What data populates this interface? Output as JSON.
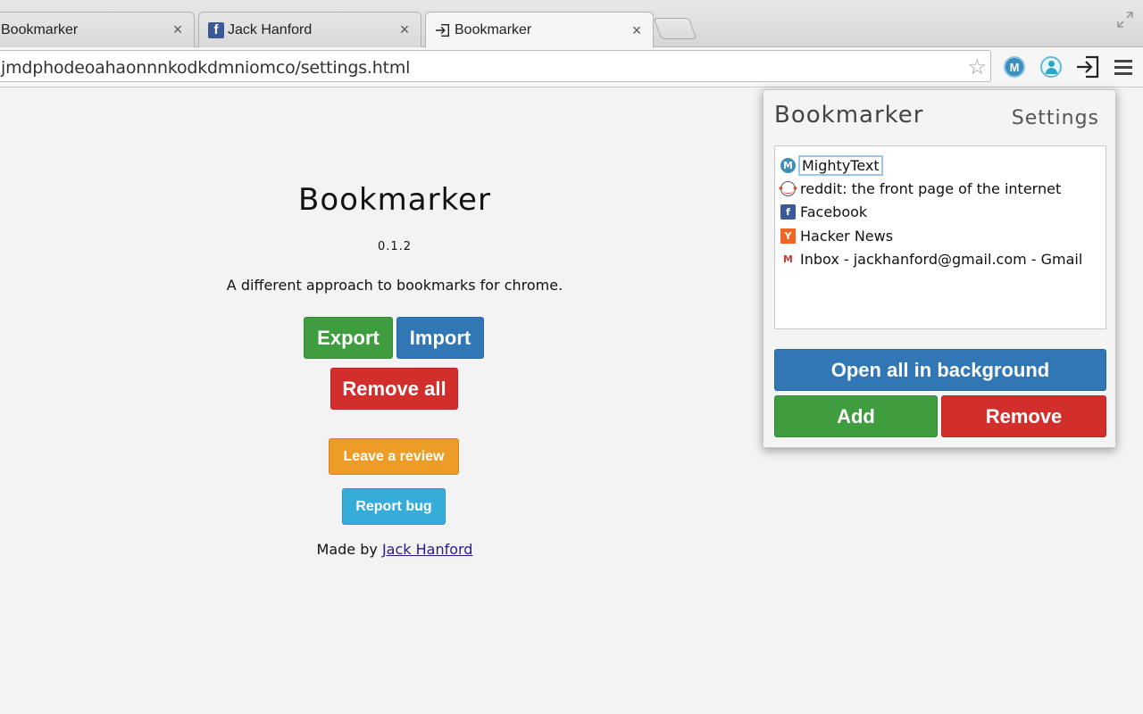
{
  "tabs": [
    {
      "label": "Bookmarker",
      "close": "×"
    },
    {
      "label": "Jack Hanford",
      "close": "×",
      "favicon": "f"
    },
    {
      "label": "Bookmarker",
      "close": "×"
    }
  ],
  "toolbar": {
    "url": "jmdphodeoahaonnnkodkdmniomco/settings.html",
    "mightytext_icon": "M"
  },
  "settings_page": {
    "title": "Bookmarker",
    "version": "0.1.2",
    "description": "A different approach to bookmarks for chrome.",
    "export_label": "Export",
    "import_label": "Import",
    "remove_all_label": "Remove all",
    "review_label": "Leave a review",
    "bug_label": "Report bug",
    "made_by_prefix": "Made by",
    "author": "Jack Hanford"
  },
  "popup": {
    "title": "Bookmarker",
    "settings_label": "Settings",
    "bookmarks": [
      {
        "label": "MightyText",
        "icon": "mightytext-icon",
        "glyph": "M",
        "selected": true
      },
      {
        "label": "reddit: the front page of the internet",
        "icon": "reddit-icon",
        "glyph": "•‿•"
      },
      {
        "label": "Facebook",
        "icon": "facebook-icon",
        "glyph": "f"
      },
      {
        "label": "Hacker News",
        "icon": "hackernews-icon",
        "glyph": "Y"
      },
      {
        "label": "Inbox - jackhanford@gmail.com - Gmail",
        "icon": "gmail-icon",
        "glyph": "M"
      }
    ],
    "open_all_label": "Open all in background",
    "add_label": "Add",
    "remove_label": "Remove"
  },
  "colors": {
    "green": "#3f9d3f",
    "blue": "#3176b5",
    "red": "#d22f2c",
    "orange": "#ed9c28",
    "light_blue": "#36acd8"
  }
}
